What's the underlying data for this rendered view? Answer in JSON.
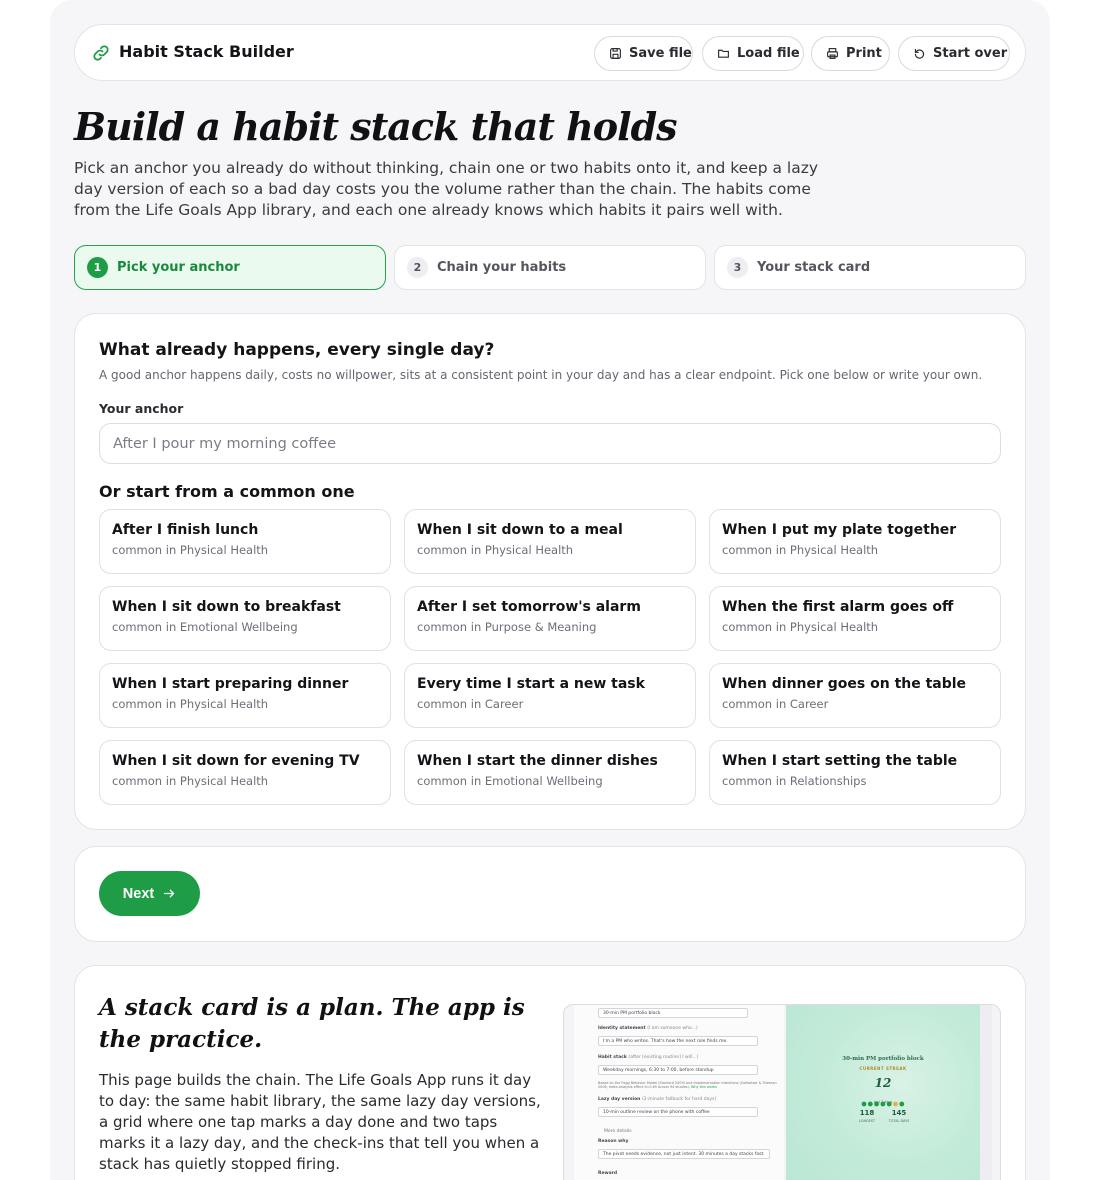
{
  "header": {
    "title": "Habit Stack Builder",
    "buttons": [
      {
        "label": "Save file",
        "icon": "save-icon"
      },
      {
        "label": "Load file",
        "icon": "folder-icon"
      },
      {
        "label": "Print",
        "icon": "printer-icon"
      },
      {
        "label": "Start over",
        "icon": "undo-icon"
      }
    ]
  },
  "hero": {
    "title": "Build a habit stack that holds",
    "intro": "Pick an anchor you already do without thinking, chain one or two habits onto it, and keep a lazy day version of each so a bad day costs you the volume rather than the chain. The habits come from the Life Goals App library, and each one already knows which habits it pairs well with."
  },
  "steps": [
    {
      "num": "1",
      "label": "Pick your anchor",
      "active": true
    },
    {
      "num": "2",
      "label": "Chain your habits",
      "active": false
    },
    {
      "num": "3",
      "label": "Your stack card",
      "active": false
    }
  ],
  "anchor_card": {
    "question": "What already happens, every single day?",
    "help": "A good anchor happens daily, costs no willpower, sits at a consistent point in your day and has a clear endpoint. Pick one below or write your own.",
    "field_label": "Your anchor",
    "placeholder": "After I pour my morning coffee",
    "value": "",
    "common_title": "Or start from a common one",
    "options": [
      {
        "title": "After I finish lunch",
        "sub": "common in Physical Health"
      },
      {
        "title": "When I sit down to a meal",
        "sub": "common in Physical Health"
      },
      {
        "title": "When I put my plate together",
        "sub": "common in Physical Health"
      },
      {
        "title": "When I sit down to breakfast",
        "sub": "common in Emotional Wellbeing"
      },
      {
        "title": "After I set tomorrow's alarm",
        "sub": "common in Purpose & Meaning"
      },
      {
        "title": "When the first alarm goes off",
        "sub": "common in Physical Health"
      },
      {
        "title": "When I start preparing dinner",
        "sub": "common in Physical Health"
      },
      {
        "title": "Every time I start a new task",
        "sub": "common in Career"
      },
      {
        "title": "When dinner goes on the table",
        "sub": "common in Career"
      },
      {
        "title": "When I sit down for evening TV",
        "sub": "common in Physical Health"
      },
      {
        "title": "When I start the dinner dishes",
        "sub": "common in Emotional Wellbeing"
      },
      {
        "title": "When I start setting the table",
        "sub": "common in Relationships"
      }
    ]
  },
  "nav": {
    "next_label": "Next",
    "next_icon": "arrow-right-icon"
  },
  "promo": {
    "title": "A stack card is a plan. The app is the practice.",
    "body": "This page builds the chain. The Life Goals App runs it day to day: the same habit library, the same lazy day versions, a grid where one tap marks a day done and two taps marks it a lazy day, and the check-ins that tell you when a stack has quietly stopped firing.",
    "screenshot": {
      "form": {
        "top_value": "30-min PM portfolio block",
        "identity_label": "Identity statement",
        "identity_hint": "(I am someone who...)",
        "identity_value": "I'm a PM who writes. That's how the next role finds me.",
        "stack_label": "Habit stack",
        "stack_hint": "(after [existing routine] I will...)",
        "stack_value": "Weekday mornings, 6:30 to 7:00, before standup",
        "stack_note": "Based on the Fogg Behavior Model (Stanford 2009) and Implementation Intentions (Gollwitzer & Sheeran 2006, meta-analysis effect d=0.65 across 94 studies).",
        "stack_link": "Why this works",
        "lazy_label": "Lazy day version",
        "lazy_hint": "(2-minute fallback for hard days)",
        "lazy_value": "10-min outline review on the phone with coffee",
        "more_details": "More details",
        "reason_label": "Reason why",
        "reason_value": "The pivot needs evidence, not just intent. 30 minutes a day stacks fast.",
        "reward_label": "Reward"
      },
      "streak": {
        "title": "30-min PM portfolio block",
        "label": "CURRENT STREAK",
        "value": "12",
        "caption": "last 7 days",
        "longest_value": "118",
        "longest_label": "LONGEST",
        "total_value": "145",
        "total_label": "TOTAL DAYS"
      }
    }
  },
  "colors": {
    "accent": "#1f9d46",
    "accent_light": "#ebfaef",
    "page_bg": "#f6f6f8"
  }
}
